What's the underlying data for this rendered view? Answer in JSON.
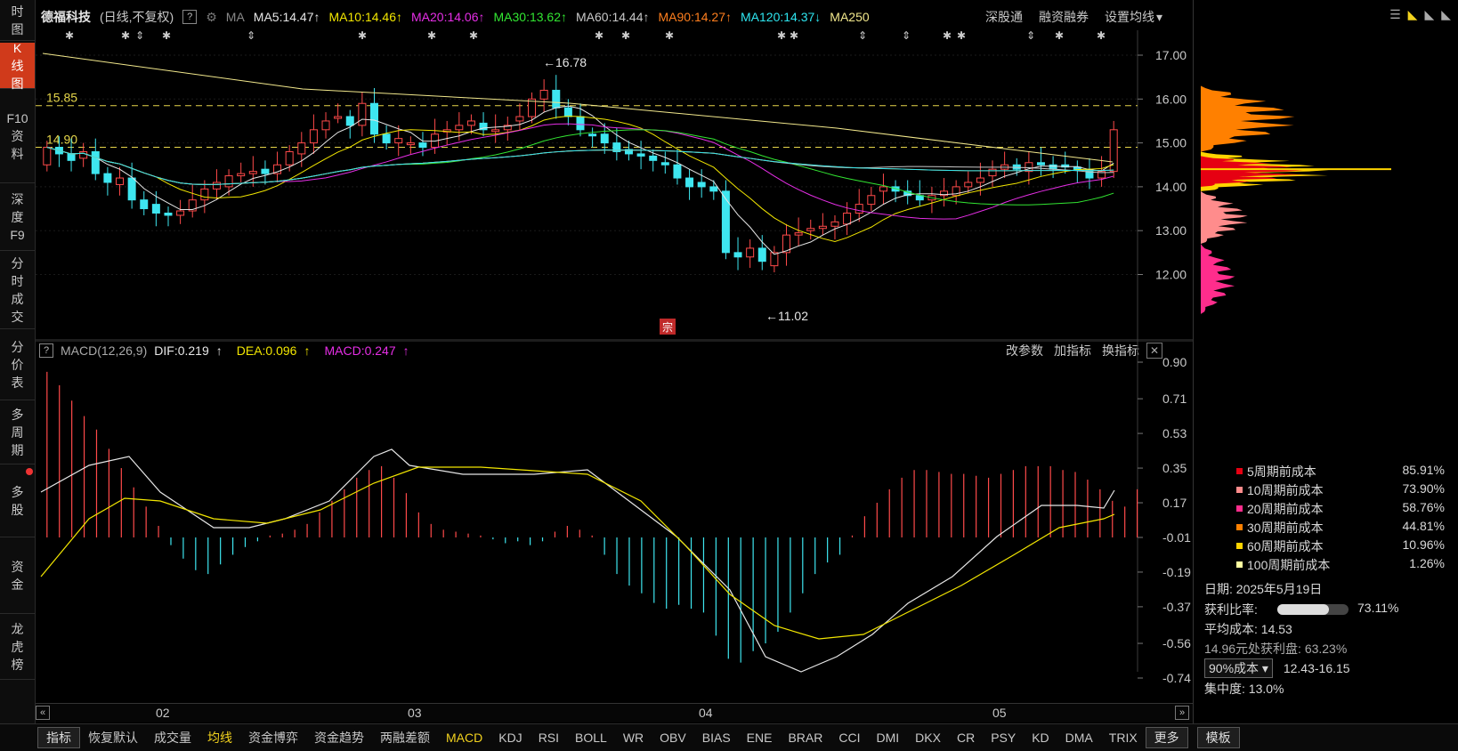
{
  "nav": [
    "时图",
    "K线图",
    "F10资料",
    "深度F9",
    "分时成交",
    "分价表",
    "多周期",
    "多股",
    "资金",
    "龙虎榜"
  ],
  "header": {
    "stock": "德福科技",
    "mode": "(日线,不复权)",
    "help": "?",
    "ma_label": "MA",
    "ma": [
      {
        "text": "MA5:14.47",
        "color": "#e6e6e6",
        "arrow": "↑"
      },
      {
        "text": "MA10:14.46",
        "color": "#f2e600",
        "arrow": "↑"
      },
      {
        "text": "MA20:14.06",
        "color": "#e62ee6",
        "arrow": "↑"
      },
      {
        "text": "MA30:13.62",
        "color": "#32e632",
        "arrow": "↑"
      },
      {
        "text": "MA60:14.44",
        "color": "#c8c8c8",
        "arrow": "↑"
      },
      {
        "text": "MA90:14.27",
        "color": "#ff7f1e",
        "arrow": "↑"
      },
      {
        "text": "MA120:14.37",
        "color": "#2ee6f0",
        "arrow": "↓"
      },
      {
        "text": "MA250",
        "color": "#f2e88c",
        "arrow": ""
      }
    ],
    "links": [
      "深股通",
      "融资融券",
      "设置均线"
    ]
  },
  "kline_axis": {
    "ticks": [
      "17.00",
      "16.00",
      "15.00",
      "14.00",
      "13.00",
      "12.00"
    ]
  },
  "annotations": {
    "high": "←16.78",
    "low": "←11.02",
    "level1": "15.85",
    "level2": "14.90",
    "badge": "宗"
  },
  "macd_header": {
    "help": "?",
    "name": "MACD(12,26,9)",
    "dif": "DIF:0.219",
    "dea": "DEA:0.096",
    "macd": "MACD:0.247",
    "links": [
      "改参数",
      "加指标",
      "换指标"
    ],
    "close": "✕"
  },
  "macd_axis": {
    "ticks": [
      "0.90",
      "0.71",
      "0.53",
      "0.35",
      "0.17",
      "-0.01",
      "-0.19",
      "-0.37",
      "-0.56",
      "-0.74"
    ]
  },
  "xaxis": {
    "labels": [
      "02",
      "03",
      "04",
      "05"
    ]
  },
  "tabs": [
    "指标",
    "恢复默认",
    "成交量",
    "均线",
    "资金博弈",
    "资金趋势",
    "两融差额",
    "MACD",
    "KDJ",
    "RSI",
    "BOLL",
    "WR",
    "OBV",
    "BIAS",
    "ENE",
    "BRAR",
    "CCI",
    "DMI",
    "DKX",
    "CR",
    "PSY",
    "KD",
    "DMA",
    "TRIX",
    "更多",
    "模板"
  ],
  "cost": {
    "legend": [
      {
        "label": "5周期前成本",
        "value": "85.91%",
        "color": "#e60012"
      },
      {
        "label": "10周期前成本",
        "value": "73.90%",
        "color": "#ff8c8c"
      },
      {
        "label": "20周期前成本",
        "value": "58.76%",
        "color": "#ff2d8c"
      },
      {
        "label": "30周期前成本",
        "value": "44.81%",
        "color": "#ff8000"
      },
      {
        "label": "60周期前成本",
        "value": "10.96%",
        "color": "#ffd400"
      },
      {
        "label": "100周期前成本",
        "value": "1.26%",
        "color": "#ffffa0"
      }
    ],
    "date": "日期: 2025年5月19日",
    "profit_label": "获利比率:",
    "profit_ratio": 0.7311,
    "profit_value": "73.11%",
    "avg_cost": "平均成本: 14.53",
    "profit_at": "14.96元处获利盘: 63.23%",
    "range_select": "90%成本",
    "range": "12.43-16.15",
    "concentration": "集中度: 13.0%"
  }
}
